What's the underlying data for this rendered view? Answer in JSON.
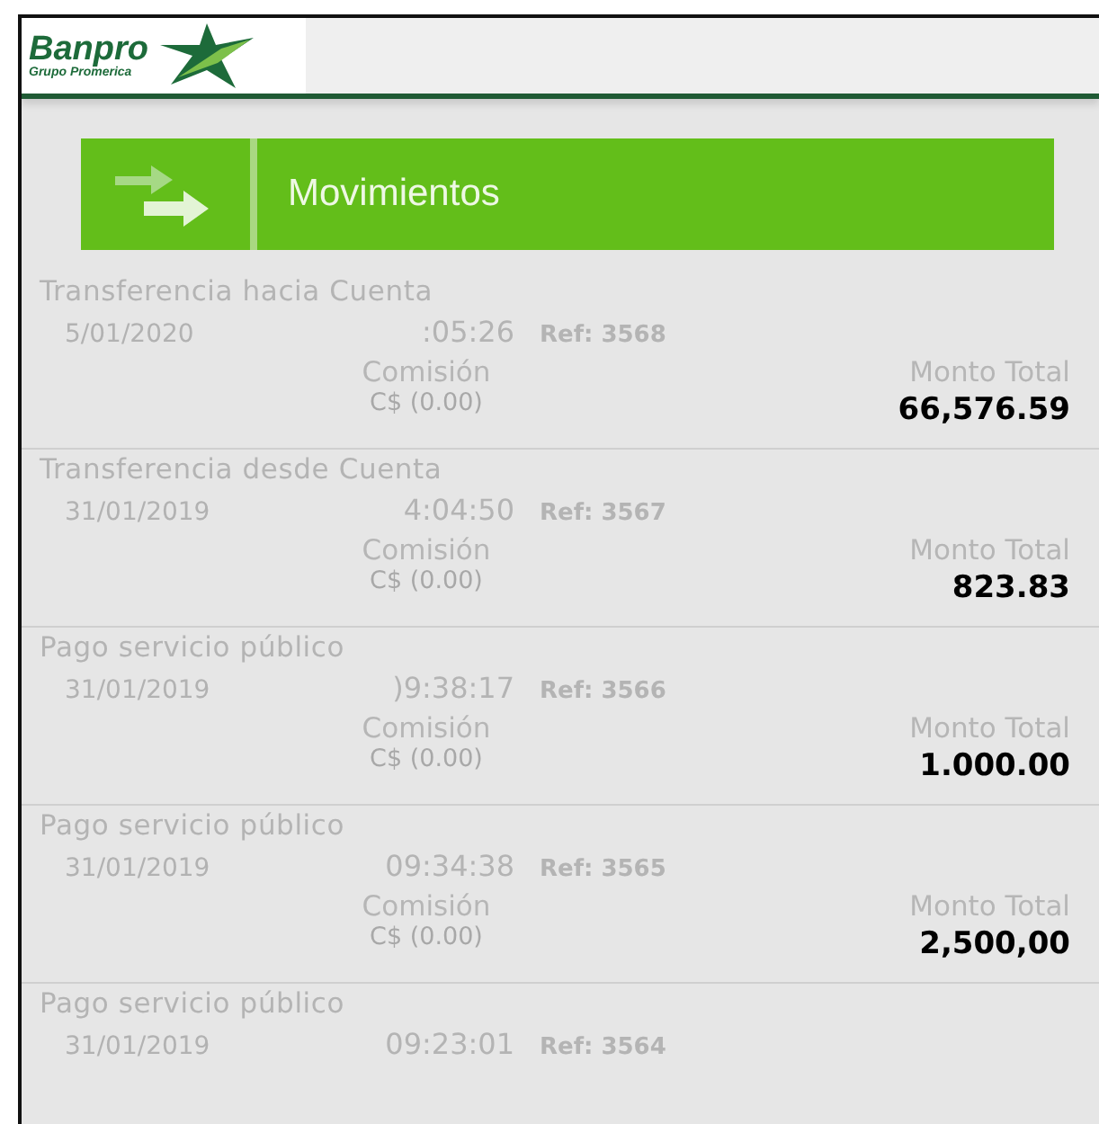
{
  "header": {
    "logo_text": "Banpro",
    "logo_subtext": "Grupo Promerica"
  },
  "section_button": {
    "label": "Movimientos"
  },
  "transactions": [
    {
      "title": "Transferencia hacia Cuenta",
      "date": "5/01/2020",
      "time": ":05:26",
      "ref": "Ref: 3568",
      "commission_label": "Comisión",
      "commission": "C$ (0.00)",
      "total_label": "Monto Total",
      "total": "66,576.59"
    },
    {
      "title": "Transferencia desde Cuenta",
      "date": "31/01/2019",
      "time": "4:04:50",
      "ref": "Ref: 3567",
      "commission_label": "Comisión",
      "commission": "C$ (0.00)",
      "total_label": "Monto Total",
      "total": "823.83"
    },
    {
      "title": "Pago servicio público",
      "date": "31/01/2019",
      "time": ")9:38:17",
      "ref": "Ref: 3566",
      "commission_label": "Comisión",
      "commission": "C$ (0.00)",
      "total_label": "Monto Total",
      "total": "1.000.00"
    },
    {
      "title": "Pago servicio público",
      "date": "31/01/2019",
      "time": "09:34:38",
      "ref": "Ref: 3565",
      "commission_label": "Comisión",
      "commission": "C$ (0.00)",
      "total_label": "Monto Total",
      "total": "2,500,00"
    },
    {
      "title": "Pago servicio público",
      "date": "31/01/2019",
      "time": "09:23:01",
      "ref": "Ref: 3564"
    }
  ]
}
